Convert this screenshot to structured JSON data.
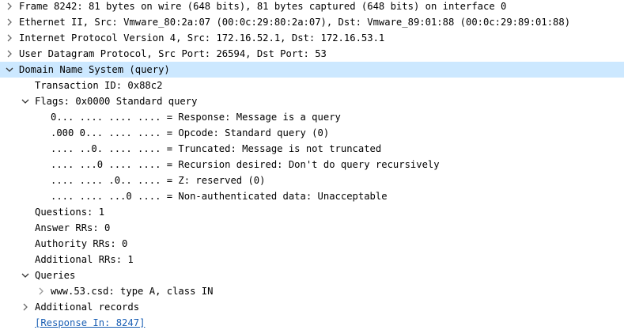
{
  "tree": {
    "frame": "Frame 8242: 81 bytes on wire (648 bits), 81 bytes captured (648 bits) on interface 0",
    "ethernet": "Ethernet II, Src: Vmware_80:2a:07 (00:0c:29:80:2a:07), Dst: Vmware_89:01:88 (00:0c:29:89:01:88)",
    "ip": "Internet Protocol Version 4, Src: 172.16.52.1, Dst: 172.16.53.1",
    "udp": "User Datagram Protocol, Src Port: 26594, Dst Port: 53",
    "dns": "Domain Name System (query)",
    "transaction_id": "Transaction ID: 0x88c2",
    "flags": "Flags: 0x0000 Standard query",
    "flag_response": "0... .... .... .... = Response: Message is a query",
    "flag_opcode": ".000 0... .... .... = Opcode: Standard query (0)",
    "flag_truncated": ".... ..0. .... .... = Truncated: Message is not truncated",
    "flag_recursion": ".... ...0 .... .... = Recursion desired: Don't do query recursively",
    "flag_z": ".... .... .0.. .... = Z: reserved (0)",
    "flag_nonauth": ".... .... ...0 .... = Non-authenticated data: Unacceptable",
    "questions": "Questions: 1",
    "answer_rrs": "Answer RRs: 0",
    "authority_rrs": "Authority RRs: 0",
    "additional_rrs": "Additional RRs: 1",
    "queries": "Queries",
    "query_item": "www.53.csd: type A, class IN",
    "additional_records": "Additional records",
    "response_in": "[Response In: 8247]"
  },
  "colors": {
    "selection": "#cce8ff",
    "link": "#1a5fb4",
    "arrow": "#6b6b6b"
  }
}
